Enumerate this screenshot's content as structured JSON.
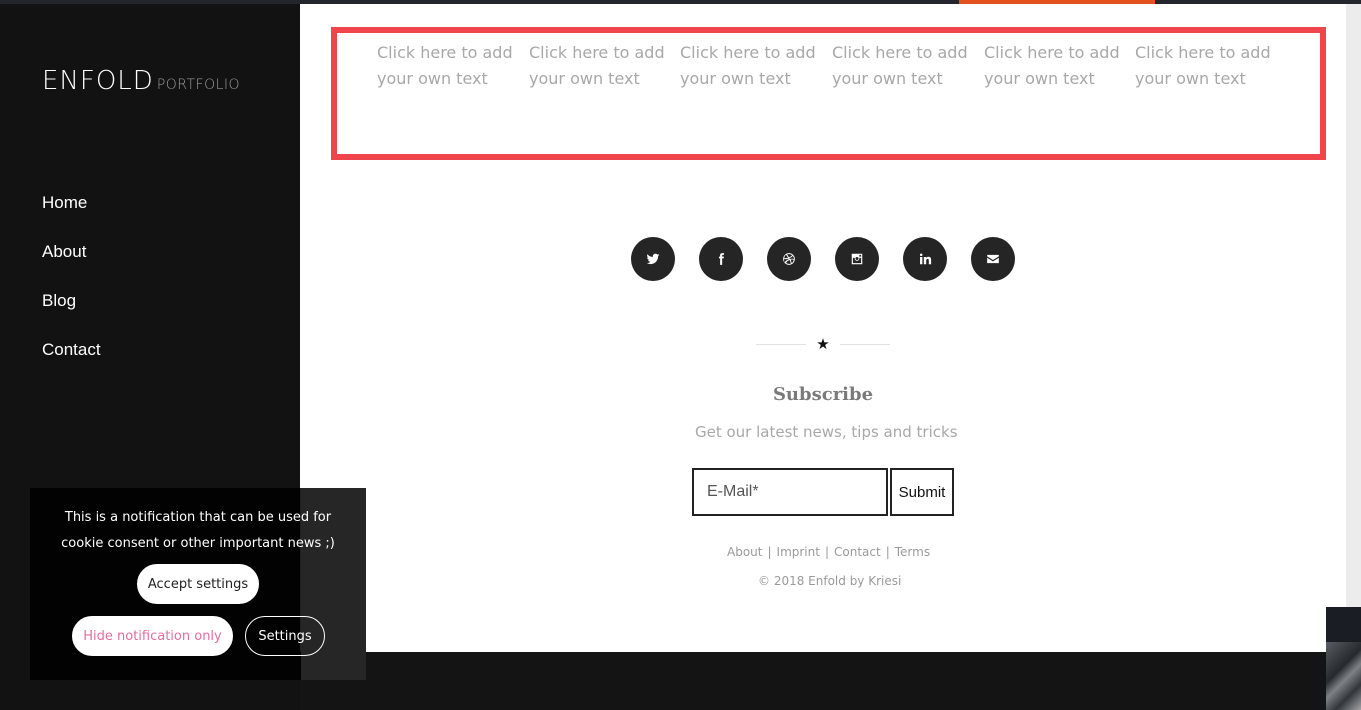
{
  "logo": {
    "main": "ENFOLD",
    "sub": "PORTFOLIO"
  },
  "nav": {
    "items": [
      {
        "label": "Home"
      },
      {
        "label": "About"
      },
      {
        "label": "Blog"
      },
      {
        "label": "Contact"
      }
    ]
  },
  "content_columns": [
    {
      "line1": "Click here to add",
      "line2": "your own text"
    },
    {
      "line1": "Click here to add",
      "line2": "your own text"
    },
    {
      "line1": "Click here to add",
      "line2": "your own text"
    },
    {
      "line1": "Click here to add",
      "line2": "your own text"
    },
    {
      "line1": "Click here to add",
      "line2": "your own text"
    },
    {
      "line1": "Click here to add",
      "line2": "your own text"
    }
  ],
  "social_icons": [
    "twitter-icon",
    "facebook-icon",
    "dribbble-icon",
    "instagram-icon",
    "linkedin-icon",
    "mail-icon"
  ],
  "divider": {
    "symbol": "★"
  },
  "subscribe": {
    "title": "Subscribe",
    "subtitle": "Get our latest news, tips and tricks",
    "email_placeholder": "E-Mail*",
    "submit_label": "Submit"
  },
  "footer": {
    "links": [
      "About",
      "Imprint",
      "Contact",
      "Terms"
    ],
    "separator": "|",
    "copyright": "© 2018 Enfold by Kriesi"
  },
  "cookie": {
    "line1": "This is a notification that can be used for",
    "line2": "cookie consent or other important news ;)",
    "accept_label": "Accept settings",
    "hide_label": "Hide notification only",
    "settings_label": "Settings"
  },
  "colors": {
    "accent": "#e2521c",
    "highlight_border": "#f1454e",
    "sidebar_bg": "#121212",
    "hide_link": "#e36f9c"
  }
}
